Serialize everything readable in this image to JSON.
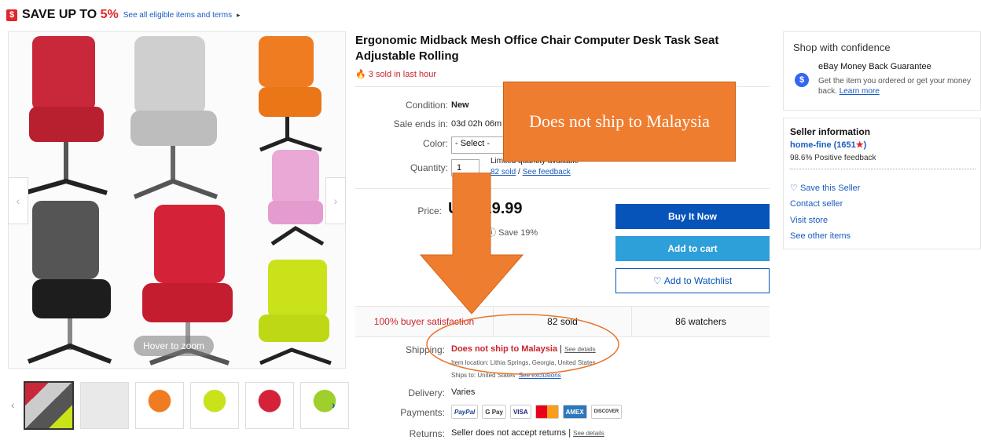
{
  "promo": {
    "text": "SAVE UP TO ",
    "percent": "5%",
    "link": "See all eligible items and terms"
  },
  "gallery": {
    "hover_label": "Hover to zoom"
  },
  "product": {
    "title": "Ergonomic Midback Mesh Office Chair Computer Desk Task Seat Adjustable Rolling",
    "sold_recent": "3 sold in last hour",
    "condition_label": "Condition:",
    "condition_value": "New",
    "sale_label": "Sale ends in:",
    "sale_value": "03d 02h 06m",
    "color_label": "Color:",
    "color_value": "- Select -",
    "quantity_label": "Quantity:",
    "quantity_value": "1",
    "qty_available": "Limited quantity available",
    "qty_sold": "82 sold",
    "qty_sep": " / ",
    "qty_feedback": "See feedback",
    "price_label": "Price:",
    "price_value": "9.99",
    "price_save": "Save 19%",
    "buy_now": "Buy It Now",
    "add_cart": "Add to cart",
    "watchlist": "Add to Watchlist"
  },
  "stats": {
    "satisfaction": "100% buyer satisfaction",
    "sold": "82 sold",
    "watchers": "86 watchers"
  },
  "shipping": {
    "label": "Shipping:",
    "value": "Does not ship to Malaysia",
    "sep": " | ",
    "details": "See details",
    "location": "Item location: Lithia Springs, Georgia, United States",
    "ships_to": "Ships to: United States",
    "exclusions": "See exclusions",
    "delivery_label": "Delivery:",
    "delivery_value": "Varies",
    "payments_label": "Payments:",
    "payments": [
      "PayPal",
      "G Pay",
      "VISA",
      "MC",
      "AMEX",
      "DISCOVER"
    ],
    "returns_label": "Returns:",
    "returns_value": "Seller does not accept returns | ",
    "returns_link": "See details"
  },
  "confidence": {
    "title": "Shop with confidence",
    "guarantee": "eBay Money Back Guarantee",
    "desc": "Get the item you ordered or get your money back. ",
    "learn": "Learn more"
  },
  "seller": {
    "title": "Seller information",
    "name": "home-fine (1651",
    "name_end": ")",
    "feedback": "98.6% Positive feedback",
    "save": "Save this Seller",
    "contact": "Contact seller",
    "store": "Visit store",
    "other": "See other items"
  },
  "overlay": {
    "text": "Does not ship to Malaysia"
  },
  "colors": {
    "accent_red": "#e0262b",
    "ebay_blue": "#3665f3",
    "button_blue": "#0654ba",
    "cart_blue": "#2d9fd9",
    "overlay_orange": "#ef7d30"
  }
}
